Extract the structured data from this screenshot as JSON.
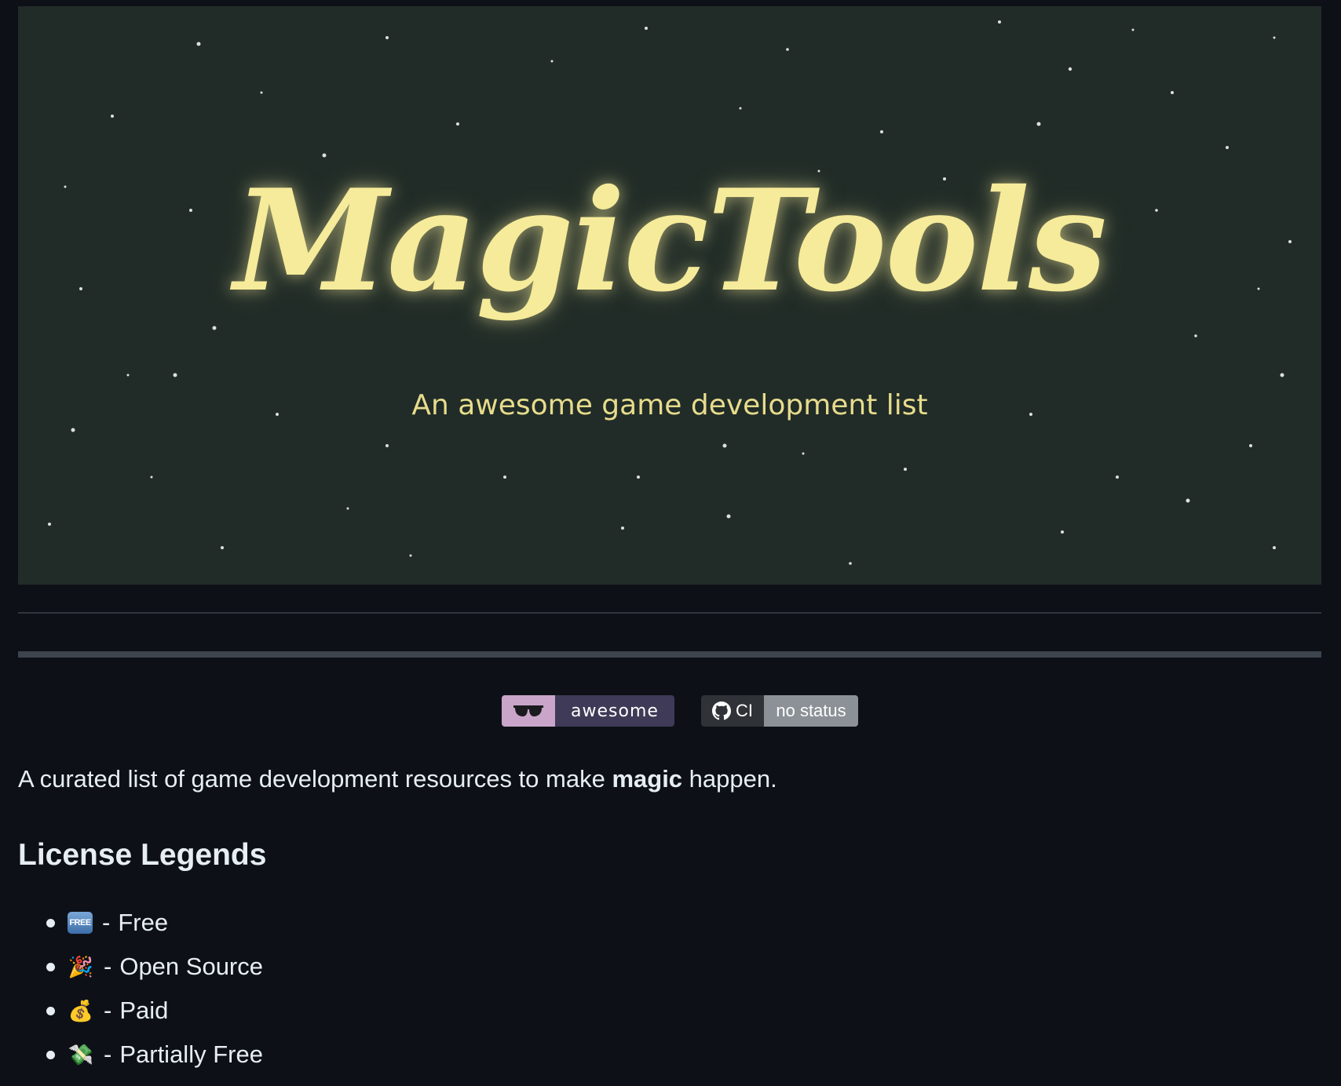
{
  "banner": {
    "title": "MagicTools",
    "subtitle": "An awesome game development list"
  },
  "badges": {
    "awesome": {
      "label": "awesome",
      "icon": "sunglasses-icon"
    },
    "ci": {
      "label": "CI",
      "status": "no status",
      "icon": "github-icon"
    }
  },
  "description": {
    "before": "A curated list of game development resources to make ",
    "bold": "magic",
    "after": " happen."
  },
  "license": {
    "heading": "License Legends",
    "separator": "-",
    "items": [
      {
        "icon": "free-icon",
        "glyph": "FREE",
        "label": "Free"
      },
      {
        "icon": "party-popper-icon",
        "glyph": "🎉",
        "label": "Open Source"
      },
      {
        "icon": "money-bag-icon",
        "glyph": "💰",
        "label": "Paid"
      },
      {
        "icon": "money-wings-icon",
        "glyph": "💸",
        "label": "Partially Free"
      }
    ]
  },
  "colors": {
    "page_bg": "#0d1117",
    "banner_bg": "#212c28",
    "title": "#f6eb9a",
    "text": "#e6edf3"
  }
}
